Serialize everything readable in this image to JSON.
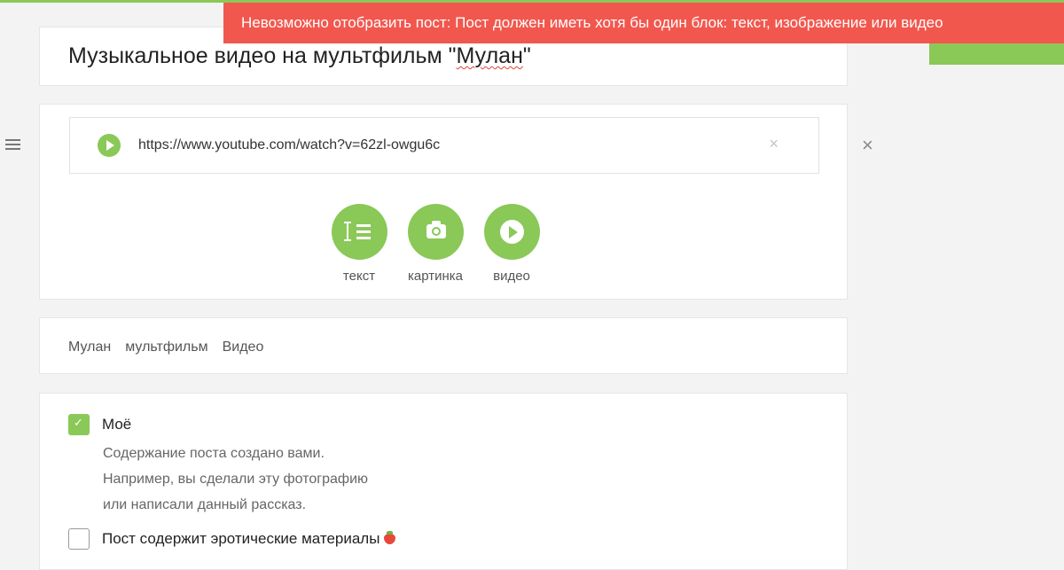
{
  "notification": {
    "error_text": "Невозможно отобразить пост: Пост должен иметь хотя бы один блок: текст, изображение или видео"
  },
  "post": {
    "title_main": "Музыкальное видео на мультфильм \"",
    "title_misspelled": "Мулан",
    "title_end": "\""
  },
  "video_block": {
    "url": "https://www.youtube.com/watch?v=62zl-owgu6c",
    "clear_icon": "×",
    "remove_icon": "×"
  },
  "add_block": {
    "text_label": "текст",
    "image_label": "картинка",
    "video_label": "видео"
  },
  "tags": [
    "Мулан",
    "мультфильм",
    "Видео"
  ],
  "options": {
    "mine": {
      "checked": true,
      "label": "Моё",
      "desc_lines": [
        "Содержание поста создано вами.",
        "Например, вы сделали эту фотографию",
        "или написали данный рассказ."
      ]
    },
    "erotic": {
      "checked": false,
      "label": "Пост содержит эротические материалы",
      "icon": "strawberry-icon"
    }
  },
  "colors": {
    "accent": "#8ac858",
    "error": "#f2574e"
  }
}
